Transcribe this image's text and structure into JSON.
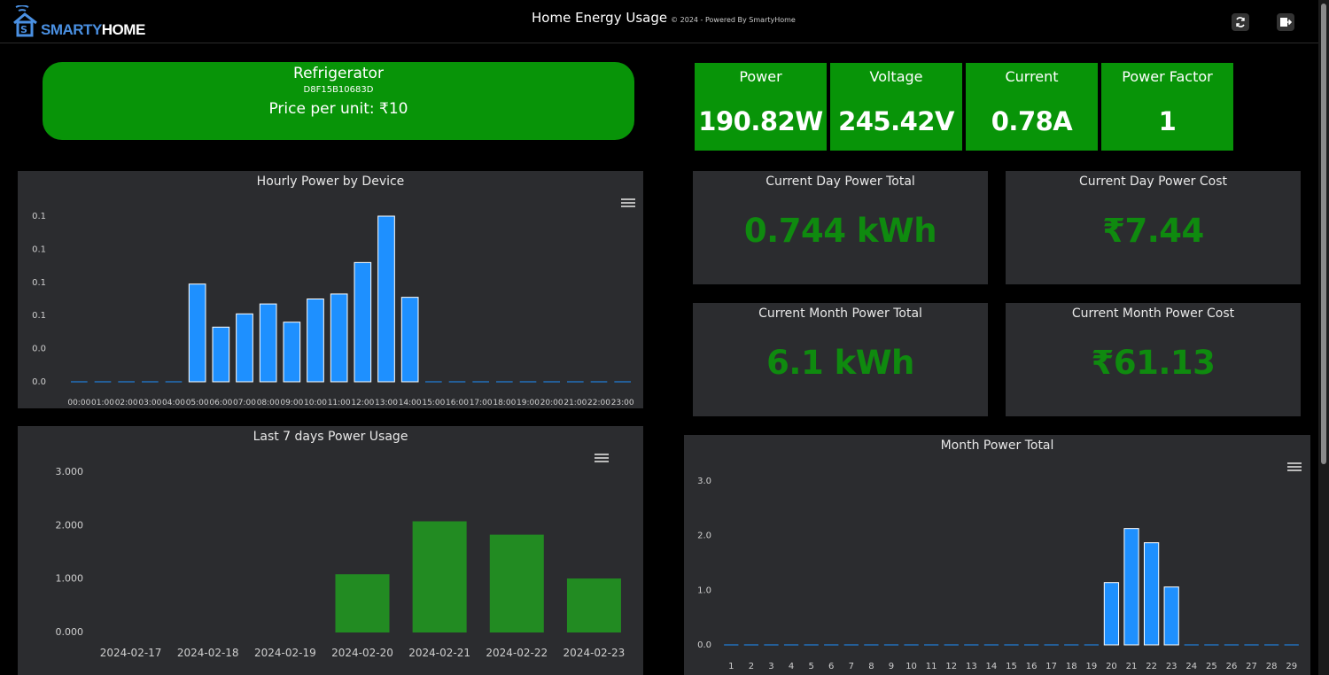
{
  "header": {
    "logo_part1": "SMARTY",
    "logo_part2": "HOME",
    "title": "Home Energy Usage",
    "subtitle": "© 2024 - Powered By SmartyHome"
  },
  "device": {
    "name": "Refrigerator",
    "id": "D8F15B10683D",
    "price_label": "Price per unit: ₹10"
  },
  "metrics": [
    {
      "label": "Power",
      "value": "190.82W"
    },
    {
      "label": "Voltage",
      "value": "245.42V"
    },
    {
      "label": "Current",
      "value": "0.78A"
    },
    {
      "label": "Power Factor",
      "value": "1"
    }
  ],
  "stats": {
    "day_total": {
      "label": "Current Day Power Total",
      "value": "0.744 kWh"
    },
    "day_cost": {
      "label": "Current Day Power Cost",
      "value": "₹7.44"
    },
    "month_total": {
      "label": "Current Month Power Total",
      "value": "6.1 kWh"
    },
    "month_cost": {
      "label": "Current Month Power Cost",
      "value": "₹61.13"
    }
  },
  "colors": {
    "green": "#089408",
    "stat_green": "#0f8a0f",
    "bar_blue": "#1e90ff",
    "bar_green": "#228b22",
    "panel": "#2b2c2f"
  },
  "icons": {
    "refresh": "refresh-icon",
    "logout": "logout-icon",
    "menu": "hamburger-menu-icon"
  },
  "chart_data": [
    {
      "type": "bar",
      "title": "Hourly Power by Device",
      "categories": [
        "00:00",
        "01:00",
        "02:00",
        "03:00",
        "04:00",
        "05:00",
        "06:00",
        "07:00",
        "08:00",
        "09:00",
        "10:00",
        "11:00",
        "12:00",
        "13:00",
        "14:00",
        "15:00",
        "16:00",
        "17:00",
        "18:00",
        "19:00",
        "20:00",
        "21:00",
        "22:00",
        "23:00"
      ],
      "values": [
        0,
        0,
        0,
        0,
        0,
        0.059,
        0.033,
        0.041,
        0.047,
        0.036,
        0.05,
        0.053,
        0.072,
        0.1,
        0.051,
        0,
        0,
        0,
        0,
        0,
        0,
        0,
        0,
        0
      ],
      "ylim": [
        0,
        0.1
      ],
      "ytick_labels": [
        "0.0",
        "0.0",
        "0.1",
        "0.1",
        "0.1",
        "0.1"
      ],
      "grid": false
    },
    {
      "type": "bar",
      "title": "Last 7 days Power Usage",
      "categories": [
        "2024-02-17",
        "2024-02-18",
        "2024-02-19",
        "2024-02-20",
        "2024-02-21",
        "2024-02-22",
        "2024-02-23"
      ],
      "values": [
        0,
        0,
        0,
        1.09,
        2.08,
        1.83,
        1.01
      ],
      "ylim": [
        0,
        3
      ],
      "ytick_labels": [
        "0.000",
        "1.000",
        "2.000",
        "3.000"
      ],
      "grid": false
    },
    {
      "type": "bar",
      "title": "Month Power Total",
      "categories": [
        "1",
        "2",
        "3",
        "4",
        "5",
        "6",
        "7",
        "8",
        "9",
        "10",
        "11",
        "12",
        "13",
        "14",
        "15",
        "16",
        "17",
        "18",
        "19",
        "20",
        "21",
        "22",
        "23",
        "24",
        "25",
        "26",
        "27",
        "28",
        "29"
      ],
      "values": [
        0,
        0,
        0,
        0,
        0,
        0,
        0,
        0,
        0,
        0,
        0,
        0,
        0,
        0,
        0,
        0,
        0,
        0,
        0,
        1.14,
        2.13,
        1.87,
        1.06,
        0,
        0,
        0,
        0,
        0,
        0
      ],
      "ylim": [
        0,
        3
      ],
      "ytick_labels": [
        "0.0",
        "1.0",
        "2.0",
        "3.0"
      ],
      "grid": false
    }
  ]
}
